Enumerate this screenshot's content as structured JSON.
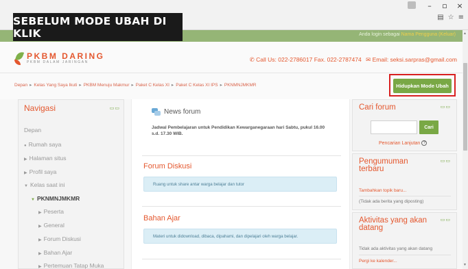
{
  "caption": "SEBELUM MODE UBAH DI KLIK",
  "browser": {
    "controls": [
      "–",
      "▫",
      "×"
    ],
    "toolbar_icons": [
      "page-icon",
      "star-icon",
      "menu-icon"
    ]
  },
  "header": {
    "login_prefix": "Anda login sebagai",
    "login_user": "Nama Pengguna (Keluar)",
    "logo_title": "PKBM DARING",
    "logo_subtitle": "PKBM DALAM JARINGAN",
    "phone": "Call Us: 022-2786017 Fax. 022-2787474",
    "email": "Email: seksi.sarpras@gmail.com"
  },
  "breadcrumb": [
    "Depan",
    "Kelas Yang Saya Ikuti",
    "PKBM Menuju Makmur",
    "Paket C Kelas XI",
    "Paket C Kelas XI IPS",
    "PKNMNJMKMR"
  ],
  "edit_button": "Hidupkan Mode Ubah",
  "navigation": {
    "title": "Navigasi",
    "ctrl": "▭▭",
    "items": [
      {
        "label": "Depan"
      },
      {
        "label": "Rumah saya"
      },
      {
        "label": "Halaman situs"
      },
      {
        "label": "Profil saya"
      },
      {
        "label": "Kelas saat ini"
      },
      {
        "label": "PKNMNJMKMR"
      },
      {
        "label": "Peserta"
      },
      {
        "label": "General"
      },
      {
        "label": "Forum Diskusi"
      },
      {
        "label": "Bahan Ajar"
      },
      {
        "label": "Pertemuan Tatap Muka"
      }
    ]
  },
  "main": {
    "news_forum": "News forum",
    "news_desc": "Jadwal Pembelajaran untuk Pendidikan Kewarganegaraan hari Sabtu, pukul 16.00 s.d. 17.30 WIB.",
    "sections": [
      {
        "title": "Forum Diskusi",
        "summary": "Ruang untuk share antar warga belajar dan tutor"
      },
      {
        "title": "Bahan Ajar",
        "summary": "Materi untuk didownload, dibaca, dipahami, dan dipelajari oleh warga belajar."
      }
    ]
  },
  "search_forum": {
    "title": "Cari forum",
    "ctrl": "▭▭",
    "button": "Cari",
    "advanced": "Pencarian Lanjutan",
    "help": "?"
  },
  "announcements": {
    "title": "Pengumuman terbaru",
    "ctrl": "▭▭",
    "add_topic": "Tambahkan topik baru...",
    "empty": "(Tidak ada berita yang diposting)"
  },
  "upcoming": {
    "title": "Aktivitas yang akan datang",
    "ctrl": "▭▭",
    "empty": "Tidak ada aktivitas yang akan datang",
    "calendar_link": "Pergi ke kalender..."
  }
}
